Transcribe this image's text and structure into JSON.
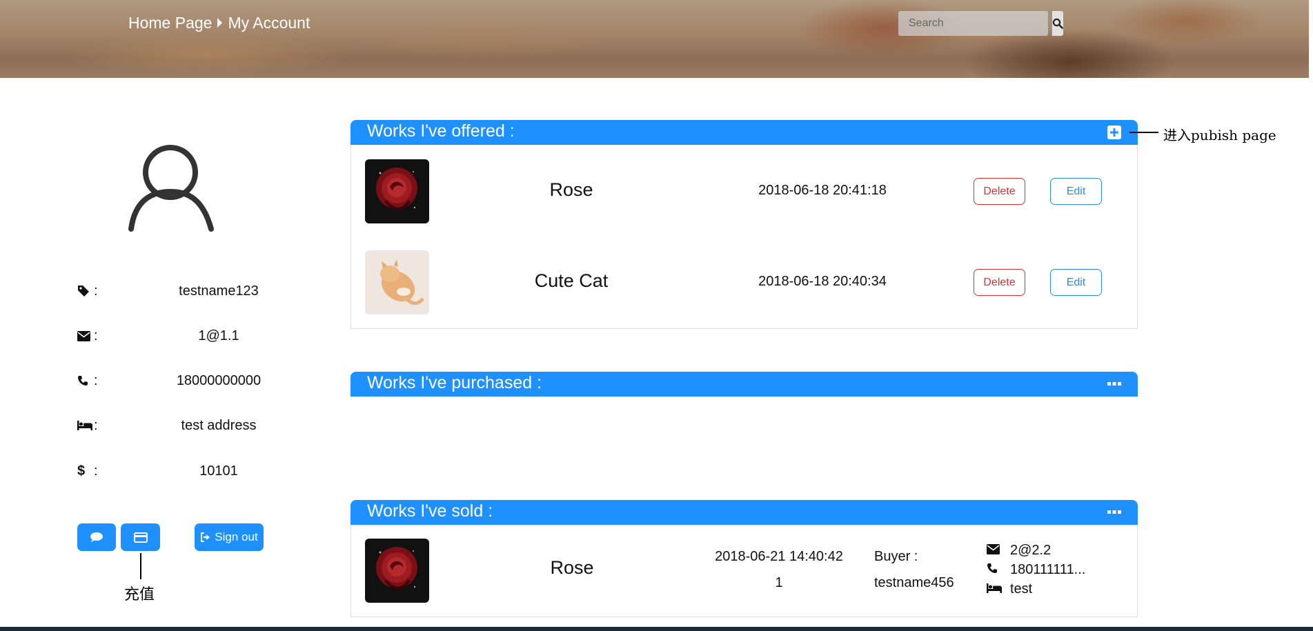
{
  "header": {
    "breadcrumb": [
      "Home Page",
      "My Account"
    ],
    "search_placeholder": "Search",
    "search_icon": "search-icon"
  },
  "profile": {
    "avatar_icon": "user-icon",
    "fields": [
      {
        "icon": "tag-icon",
        "colon": ":",
        "value": "testname123"
      },
      {
        "icon": "envelope-icon",
        "colon": ":",
        "value": "1@1.1"
      },
      {
        "icon": "phone-icon",
        "colon": ":",
        "value": "18000000000"
      },
      {
        "icon": "bed-icon",
        "colon": ":",
        "value": "test address"
      },
      {
        "icon": "dollar-icon",
        "symbol": "$",
        "colon": ":",
        "value": "10101"
      }
    ],
    "buttons": {
      "message_icon": "comment-icon",
      "recharge_icon": "credit-card-icon",
      "signout_icon": "sign-out-icon",
      "signout_label": "Sign out"
    },
    "recharge_annotation": "充值"
  },
  "offered": {
    "title": "Works I've offered :",
    "action_icon": "plus-square-icon",
    "annotation": "进入pubish page",
    "items": [
      {
        "image": "rose-image",
        "name": "Rose",
        "date": "2018-06-18 20:41:18",
        "delete_label": "Delete",
        "edit_label": "Edit"
      },
      {
        "image": "cat-image",
        "name": "Cute Cat",
        "date": "2018-06-18 20:40:34",
        "delete_label": "Delete",
        "edit_label": "Edit"
      }
    ]
  },
  "purchased": {
    "title": "Works I've purchased :",
    "action_icon": "ellipsis-icon"
  },
  "sold": {
    "title": "Works I've sold :",
    "action_icon": "ellipsis-icon",
    "items": [
      {
        "image": "rose-image",
        "name": "Rose",
        "date": "2018-06-21 14:40:42",
        "quantity": "1",
        "buyer_label": "Buyer :",
        "buyer_name": "testname456",
        "email": "2@2.2",
        "phone": "180111111...",
        "address": "test"
      }
    ]
  },
  "colors": {
    "accent": "#1e90ff",
    "danger": "#d9302f",
    "edit": "#2a8be0"
  }
}
